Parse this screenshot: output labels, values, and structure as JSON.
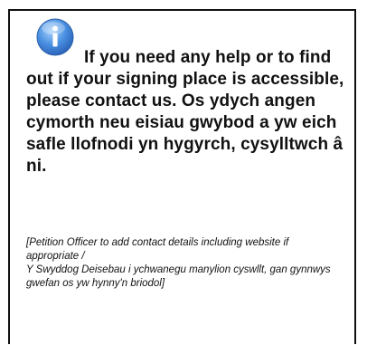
{
  "icon": "info-icon",
  "icon_colors": {
    "fill": "#3f86d8",
    "highlight": "#9cc8f5",
    "glyph": "#ffffff"
  },
  "english": "If you need any help or to find out if your signing place is accessible, please contact us.",
  "welsh": "Os ydych angen cymorth neu eisiau gwybod a yw eich safle llofnodi yn hygyrch, cysylltwch â ni.",
  "note_english": "[Petition Officer to add contact details including website if appropriate /",
  "note_welsh": "Y Swyddog Deisebau i ychwanegu manylion cyswllt, gan gynnwys gwefan os yw hynny'n briodol]"
}
